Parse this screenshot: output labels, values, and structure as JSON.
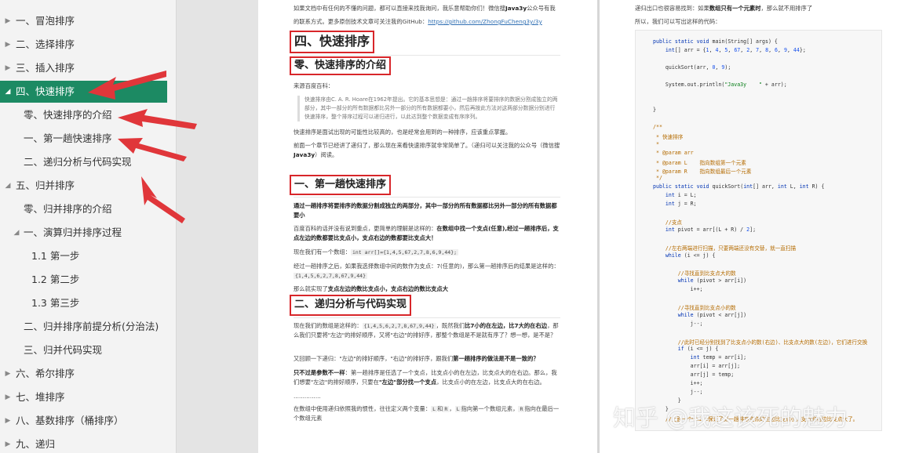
{
  "sidebar": {
    "items": [
      {
        "label": "一、冒泡排序",
        "expanded": false
      },
      {
        "label": "二、选择排序",
        "expanded": false
      },
      {
        "label": "三、插入排序",
        "expanded": false
      },
      {
        "label": "四、快速排序",
        "expanded": true,
        "active": true
      },
      {
        "label": "零、快速排序的介绍"
      },
      {
        "label": "一、第一趟快速排序"
      },
      {
        "label": "二、递归分析与代码实现"
      },
      {
        "label": "五、归并排序",
        "expanded": true
      },
      {
        "label": "零、归并排序的介绍"
      },
      {
        "label": "一、演算归并排序过程",
        "expanded": true
      },
      {
        "label": "1.1 第一步"
      },
      {
        "label": "1.2 第二步"
      },
      {
        "label": "1.3 第三步"
      },
      {
        "label": "二、归并排序前提分析(分治法)"
      },
      {
        "label": "三、归并代码实现"
      },
      {
        "label": "六、希尔排序",
        "expanded": false
      },
      {
        "label": "七、堆排序",
        "expanded": false
      },
      {
        "label": "八、基数排序（桶排序）",
        "expanded": false
      },
      {
        "label": "九、递归",
        "expanded": false
      }
    ]
  },
  "page1": {
    "intro1": "如果文档中有任何的不懂的问题，都可以直接来找我询问，我乐意帮助你们！微信搜",
    "intro1_bold": "Java3y",
    "intro1_end": "公众号有我",
    "intro2": "的联系方式。更多原创技术文章可关注我的GitHub：",
    "github_link": "https://github.com/ZhongFuCheng3y/3y",
    "h_main": "四、快速排序",
    "h_intro": "零、快速排序的介绍",
    "source_label": "来源百度百科：",
    "quote": "快速排序由C. A. R. Hoare在1962年提出。它的基本思想是：通过一趟排序将要排序的数据分割成独立的两部分，其中一部分的所有数据都比另外一部分的所有数据都要小，然后再按此方法对这两部分数据分别进行快速排序，整个排序过程可以递归进行，以此达到整个数据变成有序序列。",
    "p_interview": "快速排序是面试出现的可能性比较高的，也是经常会用到的一种排序，应该重点掌握。",
    "p_prev_pre": "前面一个章节已经讲了递归了，那么现在来看快速排序就非常简单了。（递归可以关注我的公众号（微信搜",
    "p_prev_bold": "Java3y",
    "p_prev_end": "）阅读。",
    "h_first": "一、第一趟快速排序",
    "p_first_bold": "通过一趟排序将要排序的数据分割成独立的两部分，其中一部分的所有数据都比另外一部分的所有数据都要小",
    "p_baidu_pre": "百度百科的话并没有说到重点，更简单的理解是这样的：",
    "p_baidu_bold": "在数组中找一个支点(任意),经过一趟排序后，支点左边的数都要比支点小，支点右边的数都要比支点大！",
    "p_array_pre": "现在我们有一个数组：",
    "p_array_code": "int arr[]={1,4,5,67,2,7,8,6,9,44};",
    "p_after_pre": "经过一趟排序之后，如果我选择数组中间的数作为支点：7(任意的)，那么第一趟排序后的结果是这样的：",
    "p_after_code": "{1,4,5,6,2,7,8,67,9,44}",
    "p_realized_pre": "那么就实现了",
    "p_realized_bold": "支点左边的数比支点小，支点右边的数比支点大",
    "h_recur": "二、递归分析与代码实现",
    "p_r1_pre": "现在我们的数组是这样的：",
    "p_r1_code": "{1,4,5,6,2,7,8,67,9,44}",
    "p_r1_mid": "，既然我们",
    "p_r1_bold": "比7小的在左边，比7大的在右边",
    "p_r1_end": "，那么我们只要将\"左边\"的排好顺序，又将\"右边\"的排好序，那整个数组是不是就有序了？想一想，是不是？",
    "p_r2_pre": "又回顾一下递归：\"左边\"的排好顺序，\"右边\"的排好序，跟我们",
    "p_r2_bold": "第一趟排序的做法是不是一致的？",
    "p_r3_bold1": "只不过是参数不一样",
    "p_r3_mid": "：第一趟排序是任选了一个支点，比支点小的在左边，比支点大的在右边。那么，我们想要\"左边\"的排好顺序，只要在",
    "p_r3_bold2": "\"左边\"部分找一个支点",
    "p_r3_end": "，比支点小的在左边，比支点大的在右边。",
    "p_dots": "...............",
    "p_r4_pre": "在数组中使用递归依照我的惯性，往往定义两个变量：",
    "p_r4_L": "L",
    "p_r4_and": "和",
    "p_r4_R": "R",
    "p_r4_mid": "，",
    "p_r4_L2": "L",
    "p_r4_mid2": "指向第一个数组元素，",
    "p_r4_R2": "R",
    "p_r4_end": "指向在最后一个数组元素"
  },
  "page2": {
    "line1_pre": "递归出口也很容易找到：如果",
    "line1_bold": "数组只有一个元素时",
    "line1_end": "，那么就不用排序了",
    "line2": "所以，我们可以写出这样的代码：",
    "code": [
      "public static void main(String[] args) {",
      "    int[] arr = {1, 4, 5, 67, 2, 7, 8, 6, 9, 44};",
      "",
      "    quickSort(arr, 0, 9);",
      "",
      "    System.out.println(\"Java3y    \" + arr);",
      "",
      "",
      "}",
      "",
      "/**",
      " * 快速排序",
      " *",
      " * @param arr",
      " * @param L    指向数组第一个元素",
      " * @param R    指向数组最后一个元素",
      " */",
      "public static void quickSort(int[] arr, int L, int R) {",
      "    int i = L;",
      "    int j = R;",
      "",
      "    //支点",
      "    int pivot = arr[(L + R) / 2];",
      "",
      "    //左右两端进行扫描，只要两端还没有交替，就一直扫描",
      "    while (i <= j) {",
      "",
      "        //寻找直到比支点大的数",
      "        while (pivot > arr[i])",
      "            i++;",
      "",
      "        //寻找直到比支点小的数",
      "        while (pivot < arr[j])",
      "            j--;",
      "",
      "        //此时已经分别找到了比支点小的数(右边)、比支点大的数(左边)，它们进行交换",
      "        if (i <= j) {",
      "            int temp = arr[i];",
      "            arr[i] = arr[j];",
      "            arr[j] = temp;",
      "            i++;",
      "            j--;",
      "        }",
      "    }",
      "    //上面一个while保证了第一趟排序支点的左边比支点小，支点的右边比支点大了。"
    ]
  },
  "watermark": "知乎 @我这该死的魅力",
  "colors": {
    "active": "#1c8a63",
    "heading_box": "#d8262a",
    "arrow": "#e0363a"
  }
}
